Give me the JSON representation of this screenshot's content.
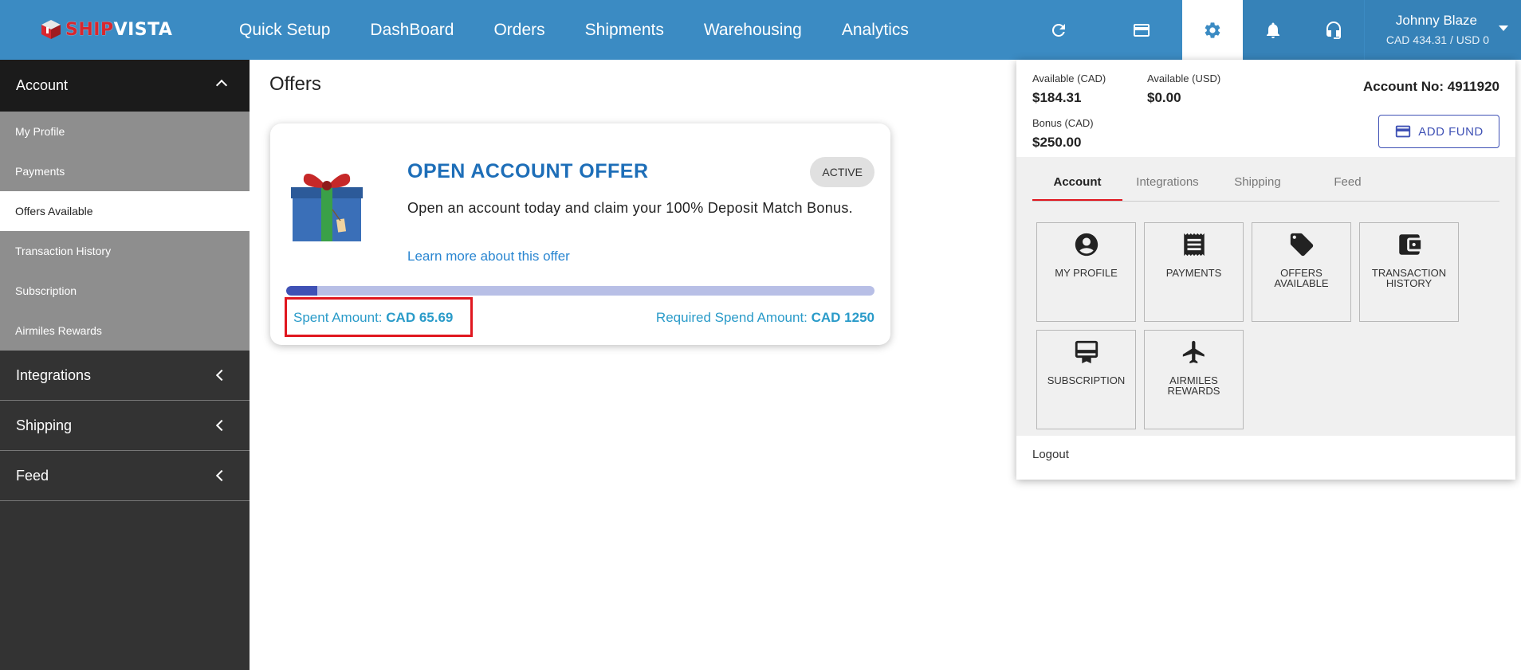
{
  "brand": {
    "name_red": "SHIP",
    "name_white": "VISTA"
  },
  "nav": {
    "items": [
      "Quick Setup",
      "DashBoard",
      "Orders",
      "Shipments",
      "Warehousing",
      "Analytics"
    ]
  },
  "user": {
    "name": "Johnny Blaze",
    "balance": "CAD 434.31 / USD 0"
  },
  "sidebar": {
    "account": "Account",
    "account_items": [
      "My Profile",
      "Payments",
      "Offers Available",
      "Transaction History",
      "Subscription",
      "Airmiles Rewards"
    ],
    "active_item": "Offers Available",
    "sections": [
      "Integrations",
      "Shipping",
      "Feed"
    ]
  },
  "page": {
    "title": "Offers"
  },
  "offer": {
    "title": "OPEN ACCOUNT OFFER",
    "status": "ACTIVE",
    "description": "Open an account today and claim your 100% Deposit Match Bonus.",
    "link": "Learn more about this offer",
    "spent_label": "Spent Amount:",
    "spent_value": "CAD 65.69",
    "required_label": "Required Spend Amount:",
    "required_value": "CAD 1250",
    "progress_fraction": 0.0526
  },
  "panel": {
    "available_cad_label": "Available (CAD)",
    "available_cad": "$184.31",
    "available_usd_label": "Available (USD)",
    "available_usd": "$0.00",
    "bonus_label": "Bonus (CAD)",
    "bonus": "$250.00",
    "account_no": "Account No: 4911920",
    "add_fund": "ADD FUND",
    "tabs": [
      "Account",
      "Integrations",
      "Shipping",
      "Feed"
    ],
    "tiles": [
      "MY PROFILE",
      "PAYMENTS",
      "OFFERS AVAILABLE",
      "TRANSACTION HISTORY",
      "SUBSCRIPTION",
      "AIRMILES REWARDS"
    ],
    "logout": "Logout"
  },
  "colors": {
    "topbar": "#3b8bc3",
    "sidebar": "#333333",
    "accent_red": "#e0171f",
    "offer_blue": "#1d6eb8",
    "amount_teal": "#2a9bc9",
    "progress": "#3f51b5"
  },
  "icons": [
    "refresh-icon",
    "credit-card-icon",
    "gear-icon",
    "bell-icon",
    "headset-icon",
    "account-circle-icon",
    "receipt-icon",
    "tag-icon",
    "wallet-icon",
    "subscription-icon",
    "airplane-icon"
  ]
}
